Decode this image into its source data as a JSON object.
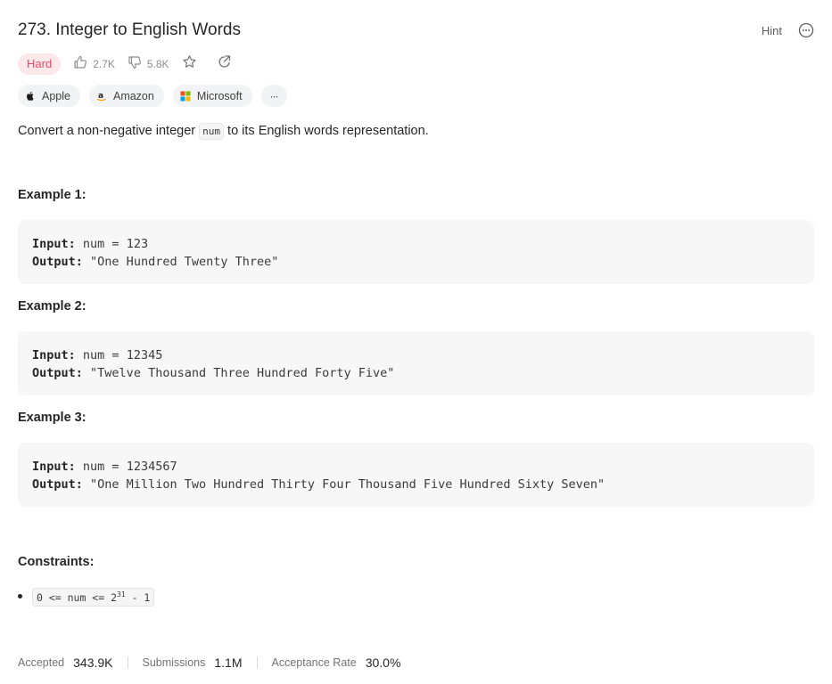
{
  "problem": {
    "title": "273. Integer to English Words",
    "hint_label": "Hint",
    "difficulty": "Hard",
    "likes": "2.7K",
    "dislikes": "5.8K",
    "description_before": "Convert a non-negative integer ",
    "description_code": "num",
    "description_after": " to its English words representation."
  },
  "companies": [
    {
      "name": "Apple",
      "icon": "apple-icon"
    },
    {
      "name": "Amazon",
      "icon": "amazon-icon"
    },
    {
      "name": "Microsoft",
      "icon": "microsoft-icon"
    }
  ],
  "companies_more_label": "···",
  "examples": [
    {
      "title": "Example 1:",
      "input_label": "Input:",
      "input": "num = 123",
      "output_label": "Output:",
      "output": "\"One Hundred Twenty Three\""
    },
    {
      "title": "Example 2:",
      "input_label": "Input:",
      "input": "num = 12345",
      "output_label": "Output:",
      "output": "\"Twelve Thousand Three Hundred Forty Five\""
    },
    {
      "title": "Example 3:",
      "input_label": "Input:",
      "input": "num = 1234567",
      "output_label": "Output:",
      "output": "\"One Million Two Hundred Thirty Four Thousand Five Hundred Sixty Seven\""
    }
  ],
  "constraints": {
    "title": "Constraints:",
    "item_prefix": "0 <= num <= 2",
    "item_exponent": "31",
    "item_suffix": " - 1"
  },
  "stats": {
    "accepted_label": "Accepted",
    "accepted_value": "343.9K",
    "submissions_label": "Submissions",
    "submissions_value": "1.1M",
    "acceptance_label": "Acceptance Rate",
    "acceptance_value": "30.0%"
  },
  "colors": {
    "hard_badge_bg": "#fde8ea",
    "hard_badge_text": "#e8496a",
    "code_bg": "#f7f7f8"
  }
}
